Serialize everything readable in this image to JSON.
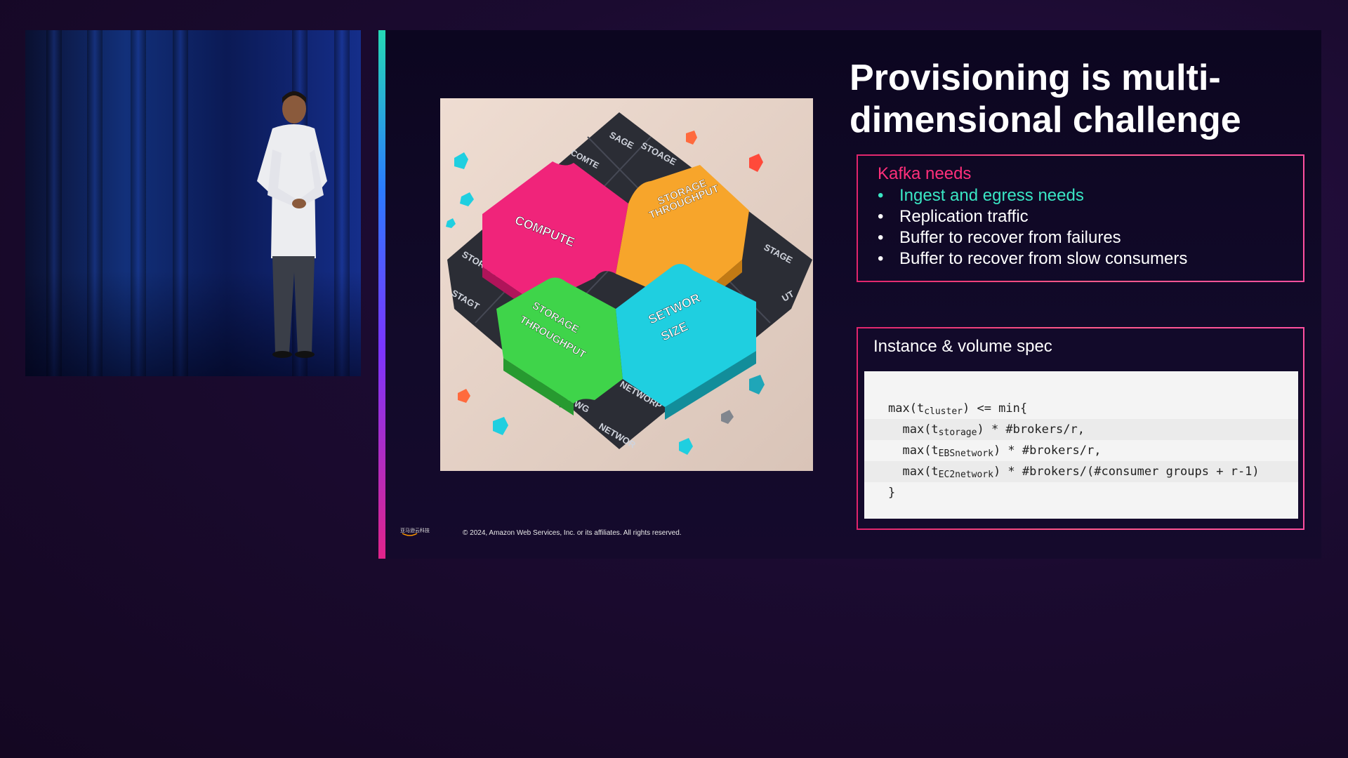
{
  "slide": {
    "title": "Provisioning is multi-dimensional challenge",
    "needs": {
      "heading": "Kafka needs",
      "items": [
        {
          "label": "Ingest and egress needs",
          "highlight": true
        },
        {
          "label": "Replication traffic",
          "highlight": false
        },
        {
          "label": "Buffer to recover from failures",
          "highlight": false
        },
        {
          "label": "Buffer to recover from slow consumers",
          "highlight": false
        }
      ]
    },
    "spec": {
      "heading": "Instance & volume spec",
      "code": {
        "l1_pre": "max(t",
        "l1_sub": "cluster",
        "l1_post": ") <= min{",
        "l2_pre": "max(t",
        "l2_sub": "storage",
        "l2_post": ") * #brokers/r,",
        "l3_pre": "max(t",
        "l3_sub": "EBSnetwork",
        "l3_post": ") * #brokers/r,",
        "l4_pre": "max(t",
        "l4_sub": "EC2network",
        "l4_post": ") * #brokers/(#consumer groups + r-1)",
        "l5": "}"
      }
    },
    "puzzle": {
      "pieces": [
        {
          "label_1": "COMPUTE",
          "label_2": "",
          "color": "#f0247a"
        },
        {
          "label_1": "STORAGE",
          "label_2": "THROUGHPUT",
          "color": "#f7a52b"
        },
        {
          "label_1": "STORAGE",
          "label_2": "THROUGHPUT",
          "color": "#3fd44a"
        },
        {
          "label_1": "SETWOR",
          "label_2": "SIZE",
          "color": "#1fcfe0"
        }
      ],
      "tiles": [
        {
          "label": "SAGE"
        },
        {
          "label": "STOAGE"
        },
        {
          "label": "COMTE"
        },
        {
          "label": "STORAGE"
        },
        {
          "label": "STAGE"
        },
        {
          "label": "STAGT"
        },
        {
          "label": "NETWORP"
        },
        {
          "label": "STWG"
        },
        {
          "label": "NETWOR"
        },
        {
          "label": "UT"
        }
      ]
    },
    "footer": {
      "logo_text": "亚马逊云科技",
      "copyright": "© 2024, Amazon Web Services, Inc. or its affiliates. All rights reserved."
    }
  },
  "colors": {
    "accent_pink": "#ff2f7a",
    "accent_teal": "#3ae6c4"
  }
}
